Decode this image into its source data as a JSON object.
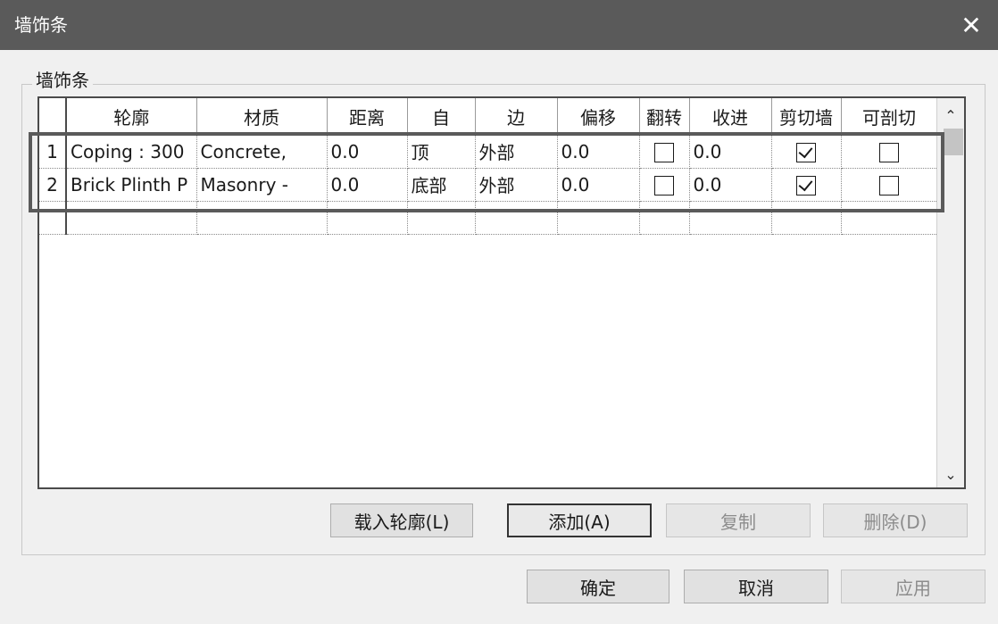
{
  "window": {
    "title": "墙饰条",
    "close_symbol": "✕"
  },
  "group": {
    "label": "墙饰条"
  },
  "grid": {
    "columns": [
      "轮廓",
      "材质",
      "距离",
      "自",
      "边",
      "偏移",
      "翻转",
      "收进",
      "剪切墙",
      "可剖切"
    ],
    "rows": [
      {
        "num": "1",
        "profile": "Coping : 300",
        "material": "Concrete,",
        "distance": "0.0",
        "from": "顶",
        "side": "外部",
        "offset": "0.0",
        "flip": false,
        "setback": "0.0",
        "cuts_wall": true,
        "cuttable": false
      },
      {
        "num": "2",
        "profile": "Brick Plinth P",
        "material": "Masonry -",
        "distance": "0.0",
        "from": "底部",
        "side": "外部",
        "offset": "0.0",
        "flip": false,
        "setback": "0.0",
        "cuts_wall": true,
        "cuttable": false
      }
    ]
  },
  "scrollbar": {
    "up_symbol": "⌃",
    "down_symbol": "⌄"
  },
  "buttons": {
    "load_profile": "载入轮廓(L)",
    "add": "添加(A)",
    "copy": "复制",
    "delete": "删除(D)",
    "ok": "确定",
    "cancel": "取消",
    "apply": "应用"
  },
  "icons": {
    "close": "close-icon",
    "checkbox": "checkbox-icon"
  },
  "colors": {
    "titlebar": "#5a5a5a",
    "highlight_border": "#5a5a5a"
  }
}
